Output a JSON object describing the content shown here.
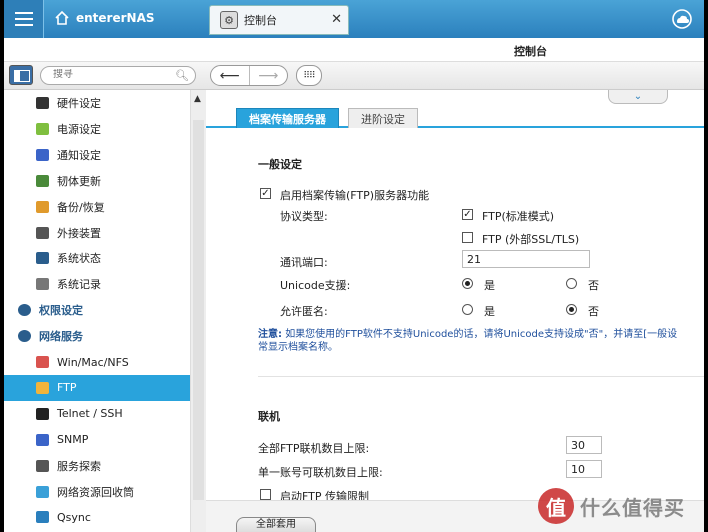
{
  "header": {
    "home_label": "entererNAS",
    "active_tab": "控制台",
    "page_title": "控制台"
  },
  "toolbar": {
    "search_placeholder": "搜寻"
  },
  "sidebar": {
    "items": [
      {
        "label": "硬件设定",
        "icon": "hardware-icon",
        "color": "#333333"
      },
      {
        "label": "电源设定",
        "icon": "bulb-icon",
        "color": "#7fbf3f"
      },
      {
        "label": "通知设定",
        "icon": "notification-icon",
        "color": "#3b64c8"
      },
      {
        "label": "韧体更新",
        "icon": "firmware-icon",
        "color": "#4a8a3a"
      },
      {
        "label": "备份/恢复",
        "icon": "backup-icon",
        "color": "#e09a2c"
      },
      {
        "label": "外接装置",
        "icon": "external-device-icon",
        "color": "#555555"
      },
      {
        "label": "系统状态",
        "icon": "monitor-icon",
        "color": "#2a5d8c"
      },
      {
        "label": "系统记录",
        "icon": "log-icon",
        "color": "#777777"
      },
      {
        "label": "权限设定",
        "icon": "user-icon",
        "color": "#2a5d8c",
        "section": true
      },
      {
        "label": "网络服务",
        "icon": "globe-icon",
        "color": "#2a5d8c",
        "section": true
      },
      {
        "label": "Win/Mac/NFS",
        "icon": "win-mac-icon",
        "color": "#d9534f"
      },
      {
        "label": "FTP",
        "icon": "ftp-folder-icon",
        "color": "#f0b43c",
        "active": true
      },
      {
        "label": "Telnet / SSH",
        "icon": "terminal-icon",
        "color": "#222222"
      },
      {
        "label": "SNMP",
        "icon": "snmp-icon",
        "color": "#3b64c8"
      },
      {
        "label": "服务探索",
        "icon": "discovery-icon",
        "color": "#555555"
      },
      {
        "label": "网络资源回收筒",
        "icon": "recycle-bin-icon",
        "color": "#3aa0d8"
      },
      {
        "label": "Qsync",
        "icon": "qsync-icon",
        "color": "#2a7fbd"
      }
    ]
  },
  "main": {
    "tabs": [
      "档案传输服务器",
      "进阶设定"
    ],
    "general": {
      "heading": "一般设定",
      "enable_ftp": "启用档案传输(FTP)服务器功能",
      "protocol_label": "协议类型:",
      "ftp_standard": "FTP(标准模式)",
      "ftp_ssl": "FTP (外部SSL/TLS)",
      "port_label": "通讯端口:",
      "port_value": "21",
      "unicode_label": "Unicode支援:",
      "anon_label": "允许匿名:",
      "yes": "是",
      "no": "否",
      "note_prefix": "注意:",
      "note_text": "如果您使用的FTP软件不支持Unicode的话，请将Unicode支持设成\"否\"，并请至[一般设",
      "note_text2": "常显示档案名称。"
    },
    "connection": {
      "heading": "联机",
      "max_ftp_label": "全部FTP联机数目上限:",
      "max_ftp_value": "30",
      "per_account_label": "单一账号可联机数目上限:",
      "per_account_value": "10",
      "limit_label": "启动FTP 传输限制"
    },
    "apply_label": "全部套用"
  },
  "watermark": {
    "badge": "值",
    "text": "什么值得买"
  }
}
